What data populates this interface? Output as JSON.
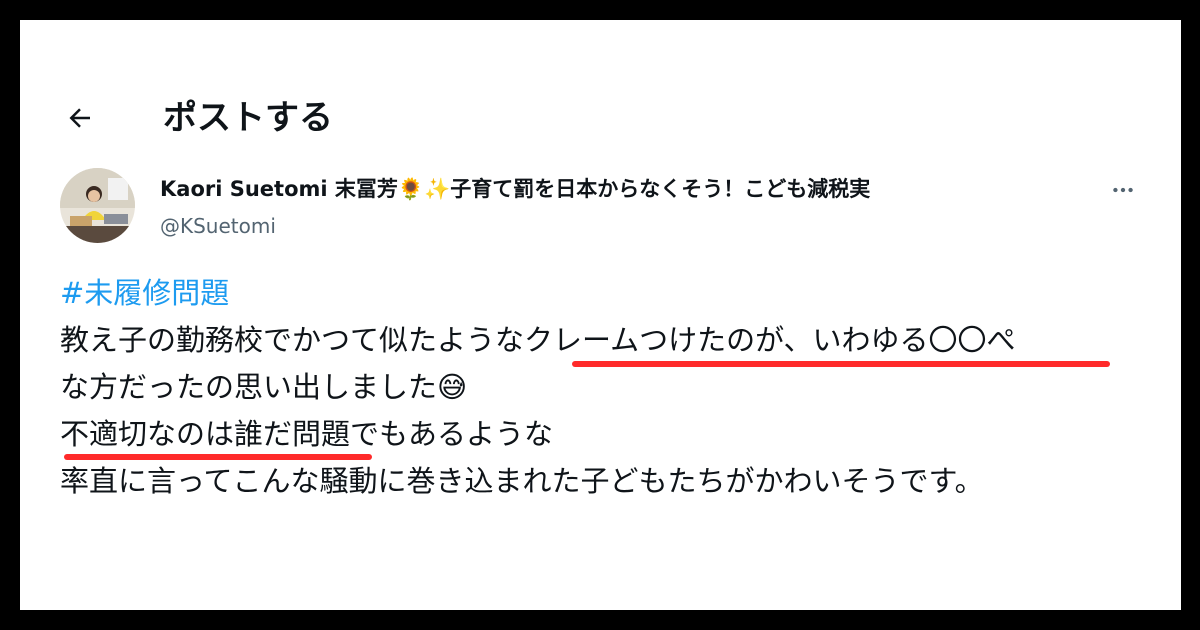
{
  "header": {
    "back_icon": "arrow-left-icon",
    "title": "ポストする"
  },
  "author": {
    "display_name": "Kaori Suetomi 末冨芳🌻✨子育て罰を日本からなくそう！こども減税実",
    "handle": "@KSuetomi",
    "more_label": "…",
    "more_icon": "more-horizontal-icon"
  },
  "post": {
    "hashtag": "#未履修問題",
    "line2": "教え子の勤務校でかつて似たようなクレームつけたのが、いわゆる〇〇ぺ",
    "line3": "な方だったの思い出しました😅",
    "line4": "不適切なのは誰だ問題でもあるような",
    "line5": "率直に言ってこんな騒動に巻き込まれた子どもたちがかわいそうです。"
  },
  "colors": {
    "background_frame": "#000000",
    "card": "#ffffff",
    "text": "#0f1419",
    "secondary": "#536471",
    "link": "#1d9bf0",
    "highlight_underline": "#ff2a2a"
  }
}
